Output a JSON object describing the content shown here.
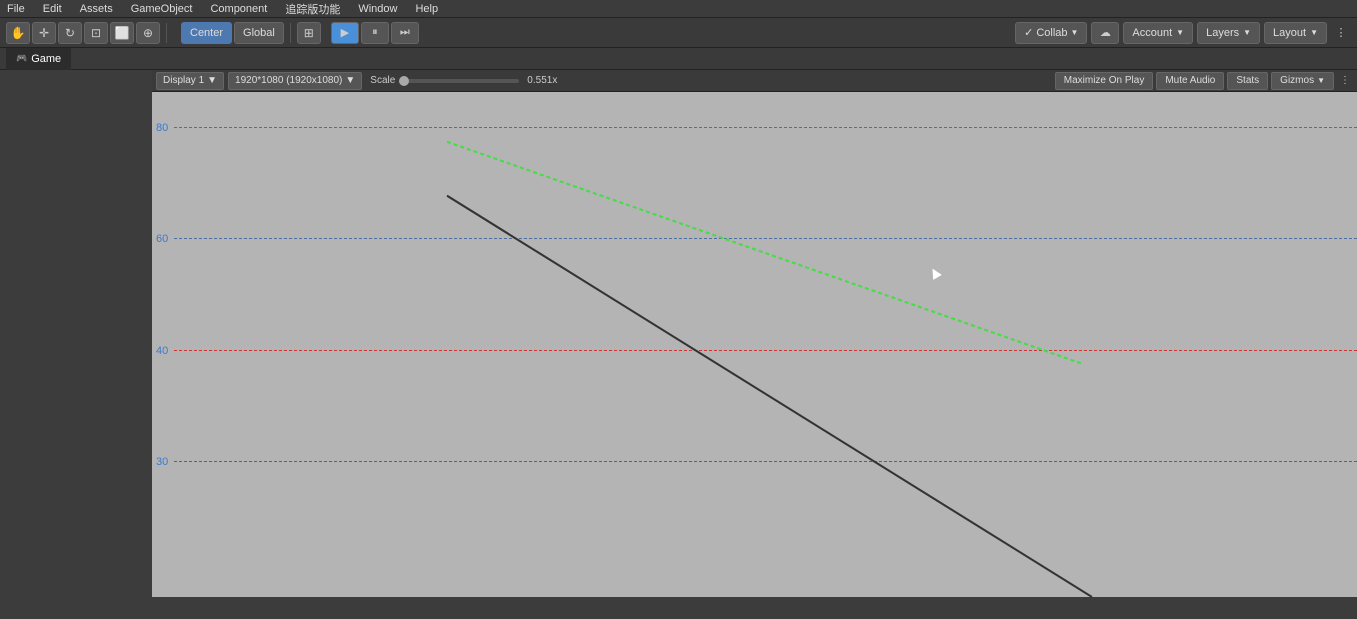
{
  "menubar": {
    "items": [
      "File",
      "Edit",
      "Assets",
      "GameObject",
      "Component",
      "追踪版功能",
      "Window",
      "Help"
    ]
  },
  "toolbar": {
    "tools": [
      {
        "id": "hand",
        "icon": "✋",
        "active": false
      },
      {
        "id": "move",
        "icon": "✛",
        "active": false
      },
      {
        "id": "rotate",
        "icon": "↻",
        "active": false
      },
      {
        "id": "scale",
        "icon": "⊡",
        "active": false
      },
      {
        "id": "rect",
        "icon": "⬜",
        "active": false
      },
      {
        "id": "multi",
        "icon": "⊕",
        "active": false
      }
    ],
    "center_label": "Center",
    "global_label": "Global",
    "collab_label": "Collab",
    "account_label": "Account",
    "layers_label": "Layers",
    "layout_label": "Layout"
  },
  "play_controls": {
    "play_icon": "▶",
    "pause_icon": "⏸",
    "step_icon": "⏭"
  },
  "game_tab": {
    "icon": "🎮",
    "label": "Game"
  },
  "game_toolbar": {
    "display_label": "Display 1",
    "resolution_label": "1920*1080 (1920x1080)",
    "scale_label": "Scale",
    "scale_value": "0.551x",
    "maximize_label": "Maximize On Play",
    "mute_label": "Mute Audio",
    "stats_label": "Stats",
    "gizmos_label": "Gizmos"
  },
  "viewport": {
    "y_labels": [
      {
        "value": "80",
        "top_pct": 6
      },
      {
        "value": "60",
        "top_pct": 28
      },
      {
        "value": "40",
        "top_pct": 52
      },
      {
        "value": "30",
        "top_pct": 74
      }
    ],
    "dashed_lines": [
      {
        "color": "blue",
        "top_pct": 6
      },
      {
        "color": "blue",
        "top_pct": 28
      },
      {
        "color": "red",
        "top_pct": 52
      },
      {
        "color": "red",
        "top_pct": 74
      }
    ],
    "green_line": {
      "x1_pct": 26,
      "y1_pct": 10,
      "x2_pct": 67,
      "y2_pct": 53
    },
    "black_line": {
      "x1_pct": 26,
      "y1_pct": 20,
      "x2_pct": 58,
      "y2_pct": 100
    }
  }
}
